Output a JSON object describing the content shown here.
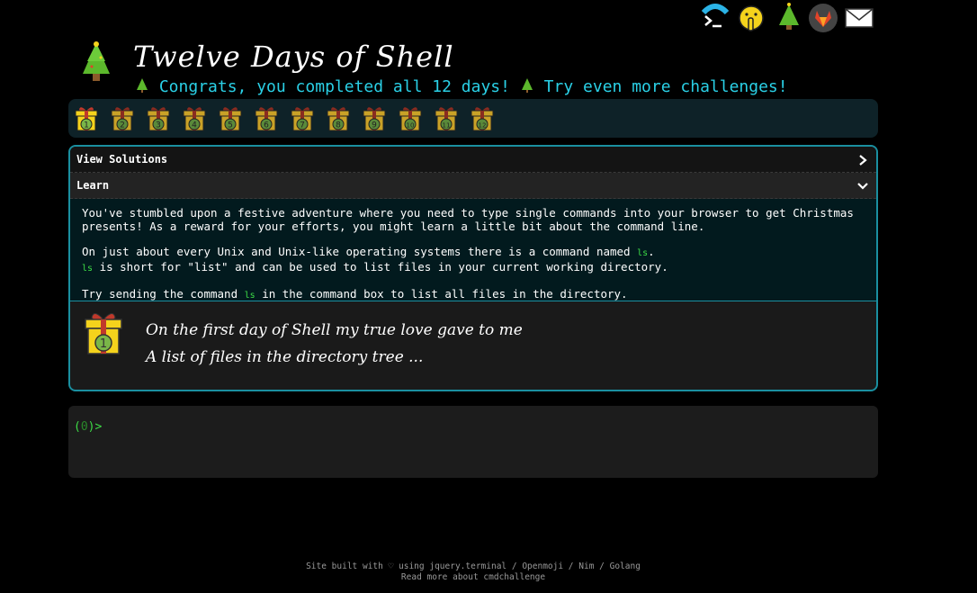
{
  "header": {
    "title": "Twelve Days of Shell",
    "congrats_text": "Congrats, you completed all 12 days!",
    "more_link": "Try even more challenges!"
  },
  "top_icons": [
    "terminal-icon",
    "shushing-face-icon",
    "christmas-tree-icon",
    "gitlab-icon",
    "envelope-icon"
  ],
  "days": [
    "1",
    "2",
    "3",
    "4",
    "5",
    "6",
    "7",
    "8",
    "9",
    "10",
    "11",
    "12"
  ],
  "panel": {
    "solutions_label": "View Solutions",
    "learn_label": "Learn",
    "learn_p1": "You've stumbled upon a festive adventure where you need to type single commands into your browser to get Christmas presents! As a reward for your efforts, you might learn a little bit about the command line.",
    "learn_p2_a": "On just about every Unix and Unix-like operating systems there is a command named ",
    "learn_p2_cmd": "ls",
    "learn_p2_b": ".",
    "learn_p2_c_cmd": "ls",
    "learn_p2_c": " is short for \"list\" and can be used to list files in your current working directory.",
    "learn_p3_a": "Try sending the command ",
    "learn_p3_cmd": "ls",
    "learn_p3_b": " in the command box to list all files in the directory.",
    "poem_line1": "On the first day of Shell my true love gave to me",
    "poem_line2": "A list of files in the directory tree ...",
    "poem_day": "1"
  },
  "terminal": {
    "prompt_open": "(",
    "prompt_num": "0",
    "prompt_close": ")>"
  },
  "footer": {
    "line1_a": "Site built with ♡ using ",
    "jquery": "jquery.terminal",
    "sep1": " / ",
    "openmoji": "Openmoji",
    "sep2": " / ",
    "nim": "Nim",
    "sep3": " / ",
    "golang": "Golang",
    "line2": "Read more about cmdchallenge"
  },
  "colors": {
    "accent_cyan": "#2ad0e6",
    "border_teal": "#1a8fa0",
    "prompt_green": "#3ddc46"
  }
}
